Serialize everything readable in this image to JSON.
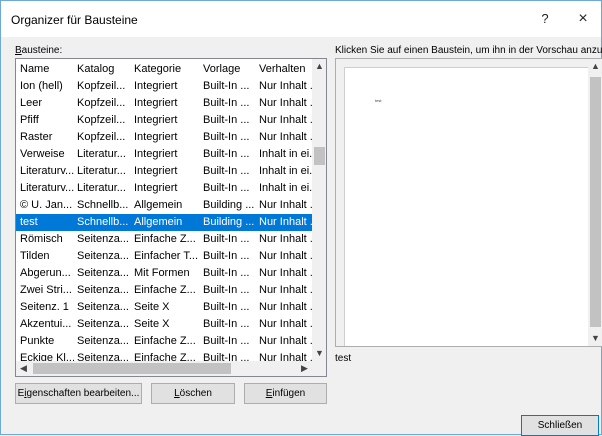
{
  "window": {
    "title": "Organizer für Bausteine",
    "help_label": "?",
    "close_label": "×"
  },
  "bausteine_label_u": "B",
  "bausteine_label_rest": "austeine:",
  "preview_label": "Klicken Sie auf einen Baustein, um ihn in der Vorschau anzuzeigen",
  "columns": [
    "Name",
    "Katalog",
    "Kategorie",
    "Vorlage",
    "Verhalten"
  ],
  "rows": [
    [
      "Ion (hell)",
      "Kopfzeil...",
      "Integriert",
      "Built-In ...",
      "Nur Inhalt ..."
    ],
    [
      " Leer",
      "Kopfzeil...",
      "Integriert",
      "Built-In ...",
      "Nur Inhalt ..."
    ],
    [
      "Pfiff",
      "Kopfzeil...",
      "Integriert",
      "Built-In ...",
      "Nur Inhalt ..."
    ],
    [
      "Raster",
      "Kopfzeil...",
      "Integriert",
      "Built-In ...",
      "Nur Inhalt ..."
    ],
    [
      "Verweise",
      "Literatur...",
      "Integriert",
      "Built-In ...",
      "Inhalt in ei..."
    ],
    [
      "Literaturv...",
      "Literatur...",
      "Integriert",
      "Built-In ...",
      "Inhalt in ei..."
    ],
    [
      "Literaturv...",
      "Literatur...",
      "Integriert",
      "Built-In ...",
      "Inhalt in ei..."
    ],
    [
      "© U. Jan...",
      "Schnellb...",
      "Allgemein",
      "Building ...",
      "Nur Inhalt ..."
    ],
    [
      "test",
      "Schnellb...",
      "Allgemein",
      "Building ...",
      "Nur Inhalt ..."
    ],
    [
      "Römisch",
      "Seitenza...",
      "Einfache Z...",
      "Built-In ...",
      "Nur Inhalt ..."
    ],
    [
      "Tilden",
      "Seitenza...",
      "Einfacher T...",
      "Built-In ...",
      "Nur Inhalt ..."
    ],
    [
      "Abgerun...",
      "Seitenza...",
      "Mit Formen",
      "Built-In ...",
      "Nur Inhalt ..."
    ],
    [
      "Zwei Stri...",
      "Seitenza...",
      "Einfache Z...",
      "Built-In ...",
      "Nur Inhalt ..."
    ],
    [
      "Seitenz. 1",
      "Seitenza...",
      "Seite X",
      "Built-In ...",
      "Nur Inhalt ..."
    ],
    [
      "Akzentui...",
      "Seitenza...",
      "Seite X",
      "Built-In ...",
      "Nur Inhalt ..."
    ],
    [
      "Punkte",
      "Seitenza...",
      "Einfache Z...",
      "Built-In ...",
      "Nur Inhalt ..."
    ],
    [
      "Eckige Kl...",
      "Seitenza...",
      "Einfache Z...",
      "Built-In ...",
      "Nur Inhalt ..."
    ]
  ],
  "selected_index": 8,
  "preview_name": "test",
  "buttons": {
    "properties_pre": "E",
    "properties_u": "i",
    "properties_post": "genschaften bearbeiten...",
    "delete_u": "L",
    "delete_post": "öschen",
    "insert_u": "E",
    "insert_post": "infügen",
    "close": "Schließen"
  },
  "colors": {
    "selection": "#0078d7",
    "border_accent": "#6da8d6"
  }
}
